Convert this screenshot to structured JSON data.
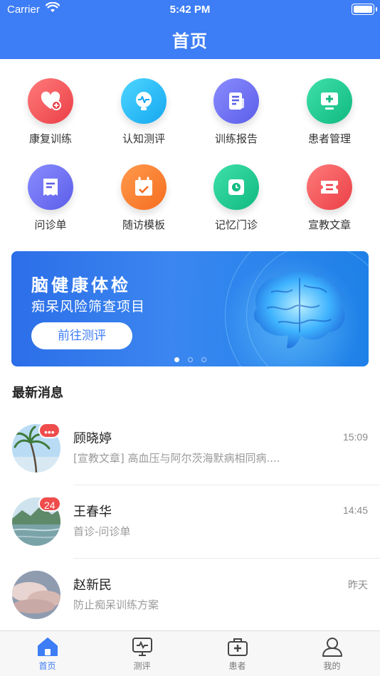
{
  "status_bar": {
    "carrier": "Carrier",
    "time": "5:42 PM"
  },
  "header": {
    "title": "首页"
  },
  "grid": [
    {
      "label": "康复训练",
      "icon": "heart-plus-icon",
      "color_from": "#ff7b7b",
      "color_to": "#ea3f46"
    },
    {
      "label": "认知测评",
      "icon": "heartbeat-monitor-icon",
      "color_from": "#4ed6ff",
      "color_to": "#15a7f0"
    },
    {
      "label": "训练报告",
      "icon": "report-document-icon",
      "color_from": "#8a8cff",
      "color_to": "#5b5ee8"
    },
    {
      "label": "患者管理",
      "icon": "medical-monitor-icon",
      "color_from": "#3ee0a8",
      "color_to": "#10b981"
    },
    {
      "label": "问诊单",
      "icon": "receipt-icon",
      "color_from": "#8a8cff",
      "color_to": "#5b5ee8"
    },
    {
      "label": "随访模板",
      "icon": "calendar-check-icon",
      "color_from": "#ff9a4d",
      "color_to": "#f56d1f"
    },
    {
      "label": "记忆门诊",
      "icon": "clock-icon",
      "color_from": "#3ee0a8",
      "color_to": "#10b981"
    },
    {
      "label": "宣教文章",
      "icon": "ticket-icon",
      "color_from": "#ff7b7b",
      "color_to": "#ea3f46"
    }
  ],
  "banner": {
    "title": "脑健康体检",
    "subtitle": "痴呆风险筛查项目",
    "button": "前往测评",
    "image": "brain-illustration",
    "slides": 3,
    "active_slide": 1
  },
  "messages_section": {
    "title": "最新消息"
  },
  "messages": [
    {
      "name": "顾晓婷",
      "time": "15:09",
      "preview": "[宣教文章] 高血压与阿尔茨海默病相同病....",
      "badge": "•••",
      "avatar": "palm-tree-photo"
    },
    {
      "name": "王春华",
      "time": "14:45",
      "preview": "首诊-问诊单",
      "badge": "24",
      "avatar": "lake-landscape-photo"
    },
    {
      "name": "赵新民",
      "time": "昨天",
      "preview": "防止痴呆训练方案",
      "badge": "",
      "avatar": "clouds-sky-photo"
    }
  ],
  "tabbar": [
    {
      "label": "首页",
      "icon": "home-icon",
      "active": true
    },
    {
      "label": "测评",
      "icon": "monitor-pulse-icon",
      "active": false
    },
    {
      "label": "患者",
      "icon": "medical-kit-icon",
      "active": false
    },
    {
      "label": "我的",
      "icon": "user-icon",
      "active": false
    }
  ],
  "colors": {
    "primary": "#3d7df5",
    "badge": "#ef4c4c"
  }
}
